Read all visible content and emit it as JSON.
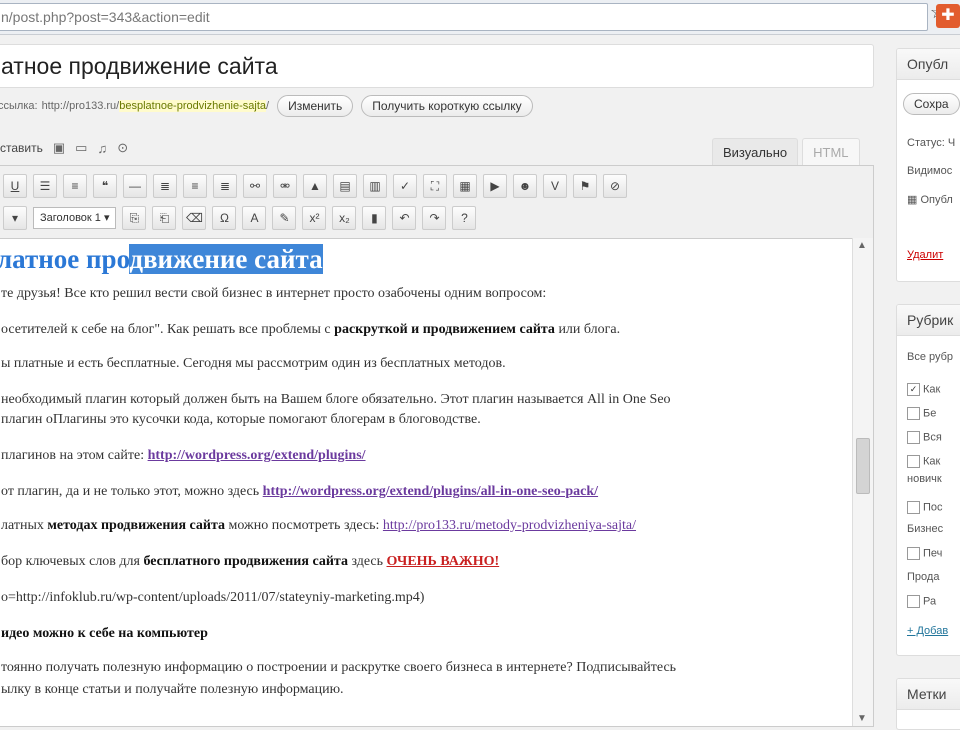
{
  "browser": {
    "url": "n/post.php?post=343&action=edit",
    "star_icon": "star-icon",
    "extension_icon": "plus-icon"
  },
  "post": {
    "title": "атное продвижение сайта",
    "permalink_label": "ссылка:",
    "permalink_base": "http://pro133.ru/",
    "permalink_slug": "besplatnoe-prodvizhenie-sajta",
    "permalink_end": "/",
    "change_button": "Изменить",
    "shortlink_button": "Получить короткую ссылку"
  },
  "media": {
    "label": "ставить"
  },
  "editor_tabs": {
    "visual": "Визуально",
    "html": "HTML"
  },
  "toolbar": {
    "format_select": "Заголовок 1"
  },
  "content": {
    "heading_a": "латное про",
    "heading_b": "движение сайта",
    "l1": "те друзья! Все кто решил вести свой бизнес в интернет просто озабочены одним вопросом:",
    "l2a": "осетителей к себе на блог\".  Как решать все проблемы с ",
    "l2b": "раскруткой и продвижением сайта",
    "l2c": " или блога.",
    "l3": "ы платные и есть бесплатные. Сегодня мы рассмотрим один из бесплатных методов.",
    "l4": " необходимый плагин который должен быть на Вашем блоге обязательно. Этот  плагин называется All in One Seo",
    "l5": "плагин оПлагины это кусочки кода, которые помогают блогерам в блоговодстве.",
    "l6a": " плагинов на этом сайте: ",
    "l6link": "http://wordpress.org/extend/plugins/",
    "l7a": "от плагин, да и не только этот, можно здесь ",
    "l7link": "http://wordpress.org/extend/plugins/all-in-one-seo-pack/",
    "l8a": "латных ",
    "l8b": "методах продвижения сайта",
    "l8c": " можно посмотреть здесь:  ",
    "l8link": "http://pro133.ru/metody-prodvizheniya-sajta/",
    "l9a": "бор ключевых слов для ",
    "l9b": "бесплатного продвижения сайта",
    "l9c": "  здесь ",
    "l9link": "ОЧЕНЬ ВАЖНО!",
    "l10": "o=http://infoklub.ru/wp-content/uploads/2011/07/stateyniy-marketing.mp4)",
    "l11": "идео можно к себе на компьютер",
    "l12": "тоянно получать полезную информацию о построении и раскрутке своего бизнеса в интернете? Подписывайтесь",
    "l13": "ылку в конце статьи и получайте полезную информацию."
  },
  "sidebar": {
    "publish": {
      "title": "Опубл",
      "save_button": "Сохра",
      "status": "Статус: Ч",
      "visibility": "Видимос",
      "published": "Опубл",
      "delete_link": "Удалит"
    },
    "categories": {
      "title": "Рубрик",
      "all": "Все рубр",
      "items": [
        "Как",
        "Бе",
        "Вся",
        "Как",
        "новичк",
        "Пос",
        "Бизнес",
        "Печ",
        "Прода",
        "Ра"
      ],
      "add_link": "+ Добав"
    },
    "tags": {
      "title": "Метки"
    }
  }
}
